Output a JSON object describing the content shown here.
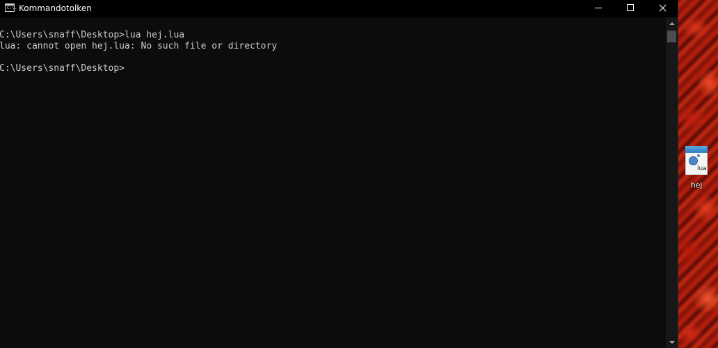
{
  "window": {
    "title": "Kommandotolken",
    "icon_text": "C:\\."
  },
  "console": {
    "lines": [
      "C:\\Users\\snaff\\Desktop>lua hej.lua",
      "lua: cannot open hej.lua: No such file or directory",
      "C:\\Users\\snaff\\Desktop>"
    ],
    "background": "#0c0c0c",
    "text_color": "#cccccc"
  },
  "desktop": {
    "icons": [
      {
        "label": "hej",
        "file_badge": "lua",
        "icon": "lua-file-icon"
      }
    ]
  }
}
